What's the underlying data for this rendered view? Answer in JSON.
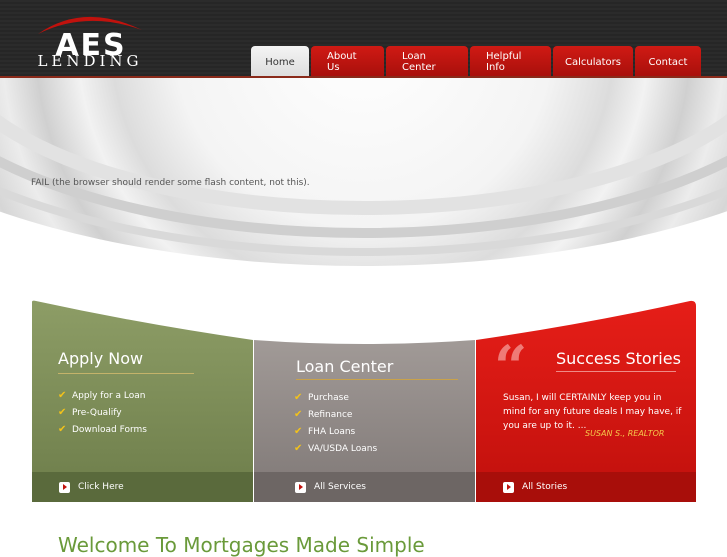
{
  "brand": {
    "logo_main": "AES",
    "logo_sub": "LENDING"
  },
  "nav": {
    "items": [
      "Home",
      "About Us",
      "Loan Center",
      "Helpful Info",
      "Calculators",
      "Contact"
    ],
    "active": "Home"
  },
  "hero": {
    "fail_text": "FAIL (the browser should render some flash content, not this)."
  },
  "apply": {
    "title": "Apply Now",
    "items": [
      "Apply for a Loan",
      "Pre-Qualify",
      "Download Forms"
    ],
    "footer": "Click Here"
  },
  "loan": {
    "title": "Loan Center",
    "items": [
      "Purchase",
      "Refinance",
      "FHA Loans",
      "VA/USDA Loans"
    ],
    "footer": "All Services"
  },
  "stories": {
    "title": "Success Stories",
    "quote": "Susan, I will CERTAINLY keep you in mind for any future deals I may have, if you are up to it. ...",
    "author": "SUSAN S., REALTOR",
    "footer": "All Stories"
  },
  "welcome": {
    "heading": "Welcome To Mortgages Made Simple"
  },
  "colors": {
    "brand_red": "#c1120d",
    "apply_green": "#7e8e5a",
    "loan_gray": "#8e8785",
    "stories_red": "#d0140f",
    "welcome_green": "#6a9a3a",
    "checkmark_yellow": "#f3c21a"
  },
  "icons": {
    "check": "checkmark-icon",
    "arrow": "arrow-right-icon",
    "quote": "quote-icon"
  }
}
